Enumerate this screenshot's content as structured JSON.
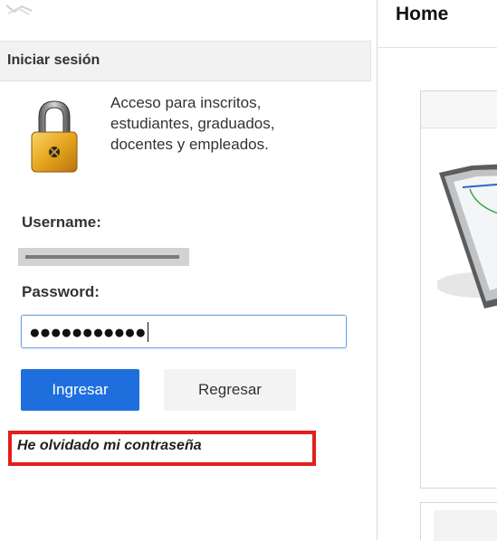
{
  "login": {
    "header": "Iniciar sesión",
    "description_lines": [
      "Acceso para inscritos,",
      "estudiantes, graduados,",
      "docentes y empleados."
    ],
    "username_label": "Username:",
    "password_label": "Password:",
    "password_value": "●●●●●●●●●●●",
    "submit_label": "Ingresar",
    "back_label": "Regresar",
    "forgot_label": "He olvidado mi contraseña"
  },
  "main": {
    "title": "Home"
  },
  "icons": {
    "lock": "padlock-icon"
  },
  "colors": {
    "primary_button": "#1e6fdd",
    "highlight_border": "#e41d1d",
    "input_focus": "#6c9fe6"
  }
}
